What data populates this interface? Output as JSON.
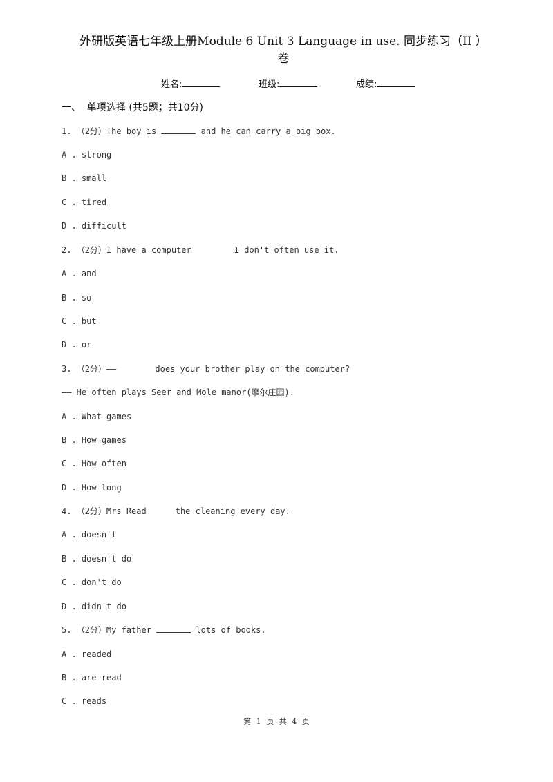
{
  "document": {
    "title_line1": "外研版英语七年级上册Module 6 Unit 3 Language in use. 同步练习（II ）",
    "title_line2": "卷",
    "info": {
      "name_label": "姓名:",
      "class_label": "班级:",
      "score_label": "成绩:"
    },
    "section": {
      "number": "一、",
      "title": "单项选择",
      "summary": "(共5题；共10分)"
    },
    "questions": [
      {
        "number": "1.",
        "points": "（2分）",
        "text_before": "The boy is",
        "text_after": "and he can carry a big box.",
        "options": [
          {
            "letter": "A .",
            "text": "strong"
          },
          {
            "letter": "B .",
            "text": "small"
          },
          {
            "letter": "C .",
            "text": "tired"
          },
          {
            "letter": "D .",
            "text": "difficult"
          }
        ]
      },
      {
        "number": "2.",
        "points": "（2分）",
        "text_before": "I have a computer",
        "text_after": "I don't often use it.",
        "options": [
          {
            "letter": "A .",
            "text": "and"
          },
          {
            "letter": "B .",
            "text": "so"
          },
          {
            "letter": "C .",
            "text": "but"
          },
          {
            "letter": "D .",
            "text": "or"
          }
        ]
      },
      {
        "number": "3.",
        "points": "（2分）",
        "text_before": "——",
        "text_after": "does your brother play on the computer?",
        "second_line": "—— He often plays Seer and Mole manor(摩尔庄园).",
        "options": [
          {
            "letter": "A .",
            "text": "What games"
          },
          {
            "letter": "B .",
            "text": "How games"
          },
          {
            "letter": "C .",
            "text": "How often"
          },
          {
            "letter": "D .",
            "text": "How long"
          }
        ]
      },
      {
        "number": "4.",
        "points": "（2分）",
        "text_before": "Mrs Read",
        "text_after": "the cleaning every day.",
        "options": [
          {
            "letter": "A .",
            "text": "doesn't"
          },
          {
            "letter": "B .",
            "text": "doesn't do"
          },
          {
            "letter": "C .",
            "text": "don't do"
          },
          {
            "letter": "D .",
            "text": "didn't do"
          }
        ]
      },
      {
        "number": "5.",
        "points": "（2分）",
        "text_before": "My father",
        "text_after": "lots of books.",
        "options": [
          {
            "letter": "A .",
            "text": "readed"
          },
          {
            "letter": "B .",
            "text": "are read"
          },
          {
            "letter": "C .",
            "text": "reads"
          }
        ]
      }
    ],
    "footer": "第 1 页 共 4 页"
  }
}
